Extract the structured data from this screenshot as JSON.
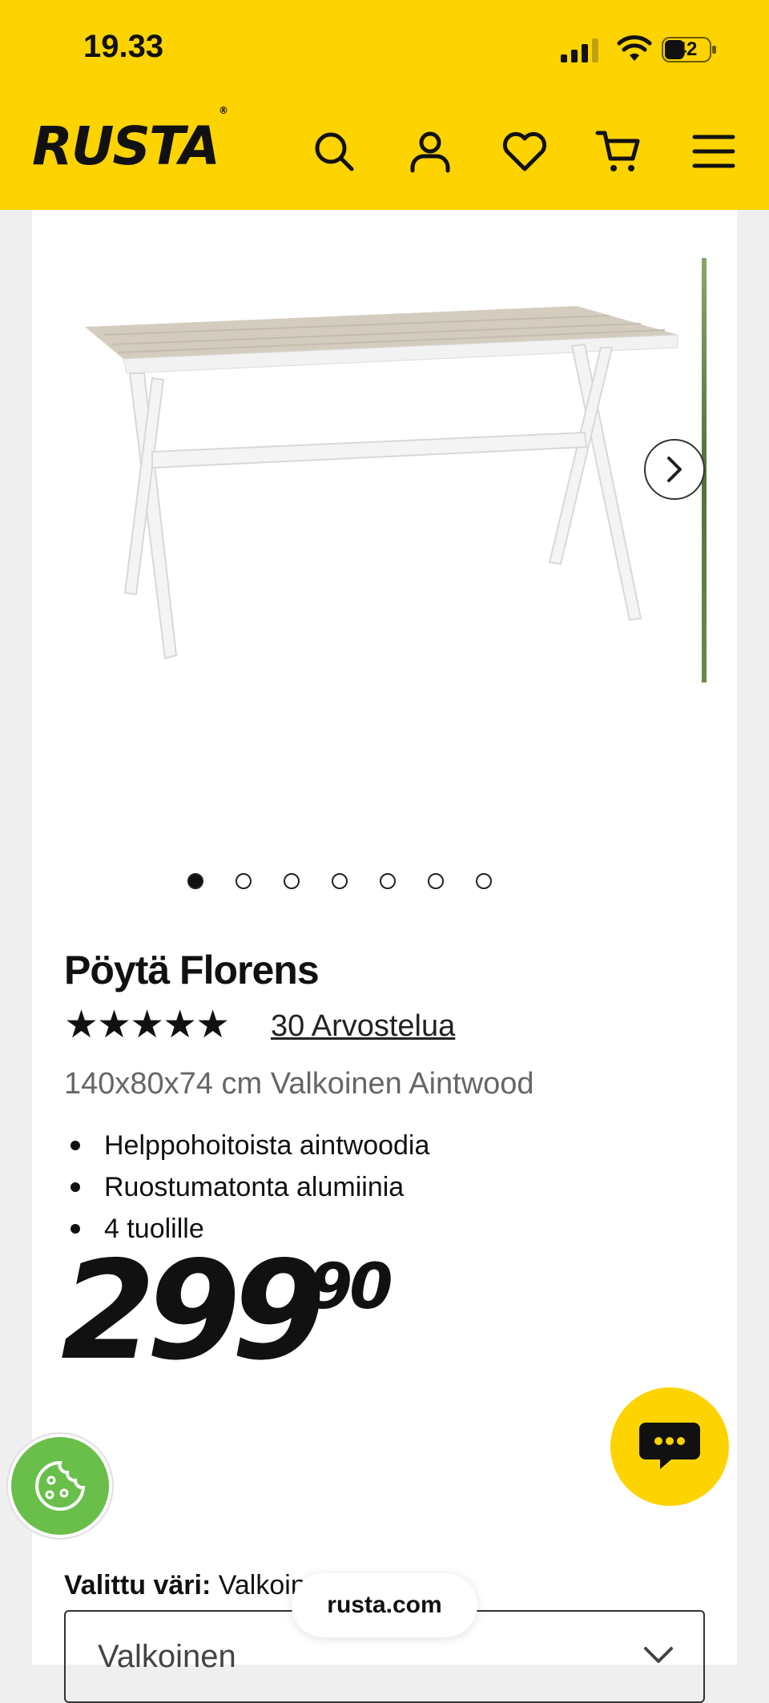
{
  "status": {
    "time": "19.33",
    "battery": "42"
  },
  "header": {
    "logo_text": "RUSTA",
    "brand_color": "#FDD300",
    "icons": [
      "search-icon",
      "user-icon",
      "heart-icon",
      "cart-icon",
      "menu-icon"
    ]
  },
  "gallery": {
    "image_alt": "Pöytä Florens",
    "slide_count": 7,
    "active_slide": 1
  },
  "product": {
    "title": "Pöytä Florens",
    "stars": "★★★★★",
    "rating": 5,
    "reviews_text": "30 Arvostelua",
    "subtitle": "140x80x74 cm Valkoinen Aintwood",
    "features": [
      "Helppohoitoista aintwoodia",
      "Ruostumatonta alumiinia",
      "4 tuolille"
    ],
    "price_main": "299",
    "price_cents": "90"
  },
  "color": {
    "label": "Valittu väri:",
    "value": "Valkoinen",
    "select_value": "Valkoinen"
  },
  "browser": {
    "url": "rusta.com"
  }
}
